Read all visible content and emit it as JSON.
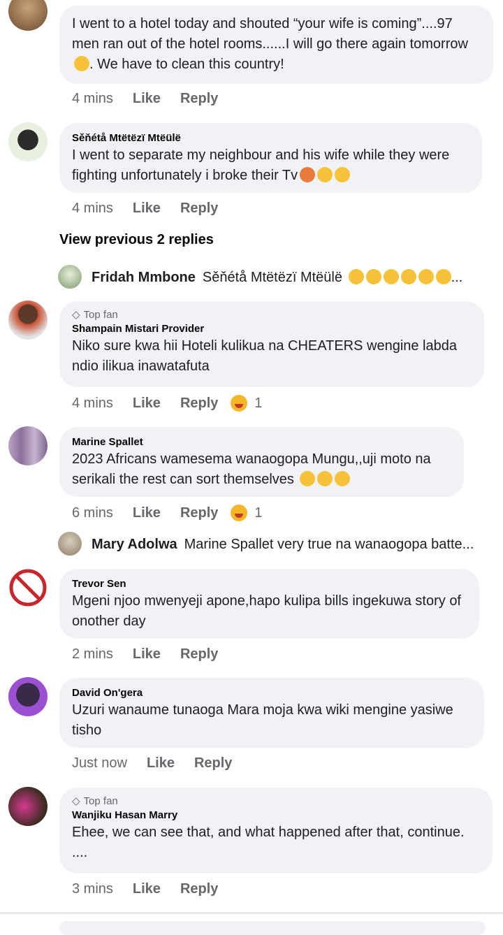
{
  "comments": [
    {
      "text": "I went to a hotel today and shouted “your wife is coming”....97 men ran out of the hotel rooms......I will go there again tomorrow",
      "text_after_emoji": ". We have to clean this country!",
      "time": "4 mins",
      "like": "Like",
      "reply": "Reply"
    },
    {
      "name": "Sěňétå Mtëtëzï Mtëülë",
      "text": "I went to separate my neighbour and his wife while they were fighting unfortunately i broke their Tv",
      "time": "4 mins",
      "like": "Like",
      "reply": "Reply"
    },
    {
      "badge": "Top fan",
      "name": "Shampain Mistari Provider",
      "text": "Niko sure kwa hii Hoteli kulikua na CHEATERS wengine labda ndio ilikua inawatafuta",
      "time": "4 mins",
      "like": "Like",
      "reply": "Reply",
      "reaction_count": "1"
    },
    {
      "name": "Marine Spallet",
      "text": "2023 Africans wamesema wanaogopa Mungu,,uji moto na serikali the rest can sort themselves",
      "time": "6 mins",
      "like": "Like",
      "reply": "Reply",
      "reaction_count": "1"
    },
    {
      "name": "Trevor Sen",
      "text": "Mgeni njoo mwenyeji apone,hapo kulipa bills ingekuwa story of onother day",
      "time": "2 mins",
      "like": "Like",
      "reply": "Reply"
    },
    {
      "name": "David On'gera",
      "text": "Uzuri wanaume tunaoga Mara moja kwa wiki mengine yasiwe tisho",
      "time": "Just now",
      "like": "Like",
      "reply": "Reply"
    },
    {
      "badge": "Top fan",
      "name": "Wanjiku Hasan Marry",
      "text": "Ehee, we can see that, and what happened after that, continue. ....",
      "time": "3 mins",
      "like": "Like",
      "reply": "Reply"
    }
  ],
  "view_previous": "View previous 2 replies",
  "reply_previews": [
    {
      "name": "Fridah Mmbone",
      "text": "Sěňétå Mtëtëzï Mtëülë"
    },
    {
      "name": "Mary Adolwa",
      "text": "Marine Spallet very true na wanaogopa batte..."
    }
  ],
  "colors": {
    "bubble": "#f0f2f5",
    "muted": "#65676b",
    "text": "#1c1e21"
  }
}
